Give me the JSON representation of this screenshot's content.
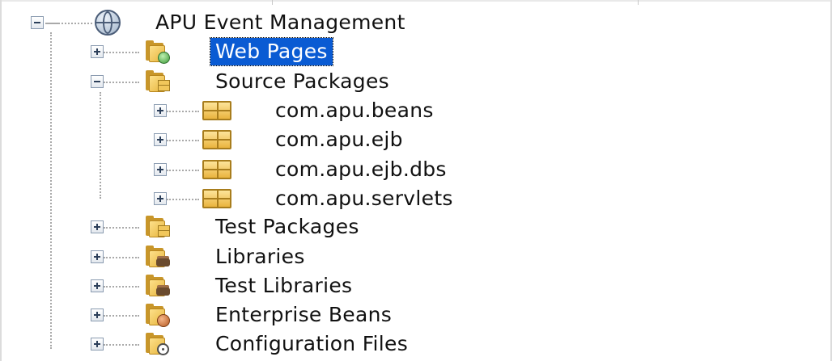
{
  "project_tree": {
    "root": {
      "label": "APU Event Management",
      "icon": "globe-icon",
      "expanded": true
    },
    "items": [
      {
        "label": "Web Pages",
        "icon": "web-pages-folder-icon",
        "expanded": false,
        "selected": true
      },
      {
        "label": "Source Packages",
        "icon": "source-packages-folder-icon",
        "expanded": true,
        "children": [
          {
            "label": "com.apu.beans",
            "icon": "package-icon",
            "expanded": false
          },
          {
            "label": "com.apu.ejb",
            "icon": "package-icon",
            "expanded": false
          },
          {
            "label": "com.apu.ejb.dbs",
            "icon": "package-icon",
            "expanded": false
          },
          {
            "label": "com.apu.servlets",
            "icon": "package-icon",
            "expanded": false
          }
        ]
      },
      {
        "label": "Test Packages",
        "icon": "test-packages-folder-icon",
        "expanded": false
      },
      {
        "label": "Libraries",
        "icon": "libraries-folder-icon",
        "expanded": false
      },
      {
        "label": "Test Libraries",
        "icon": "test-libraries-folder-icon",
        "expanded": false
      },
      {
        "label": "Enterprise Beans",
        "icon": "enterprise-beans-folder-icon",
        "expanded": false
      },
      {
        "label": "Configuration Files",
        "icon": "configuration-files-folder-icon",
        "expanded": false
      }
    ]
  },
  "colors": {
    "selection": "#0a5bd3",
    "folder": "#e7b53e",
    "text": "#111111"
  }
}
